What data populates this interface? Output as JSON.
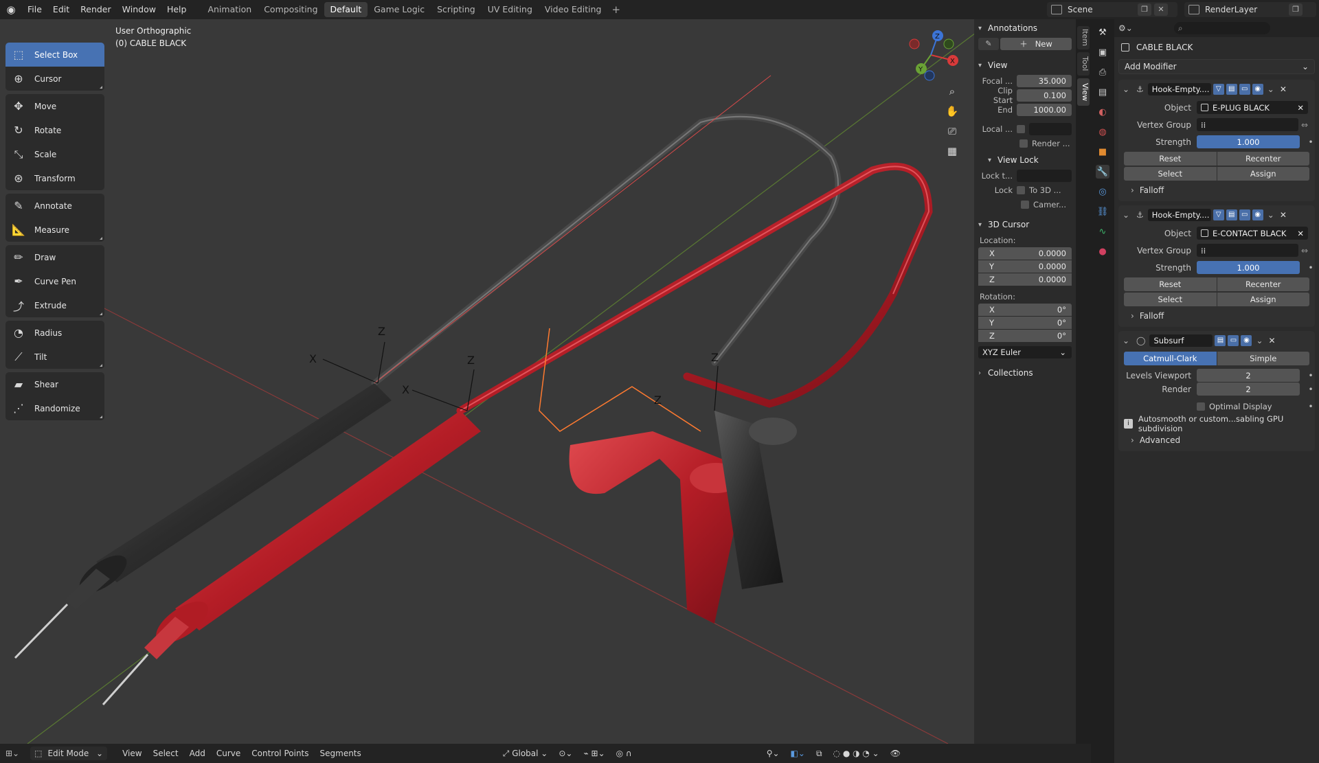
{
  "topbar": {
    "menus": [
      "File",
      "Edit",
      "Render",
      "Window",
      "Help"
    ],
    "workspaces": [
      "Animation",
      "Compositing",
      "Default",
      "Game Logic",
      "Scripting",
      "UV Editing",
      "Video Editing"
    ],
    "active_workspace": "Default",
    "add_tab": "+",
    "scene": "Scene",
    "view_layer": "RenderLayer"
  },
  "viewport": {
    "view_name": "User Orthographic",
    "object_label": "(0) CABLE BLACK",
    "gizmo_axes": [
      "X",
      "Y",
      "Z"
    ]
  },
  "toolbar": {
    "groups": [
      [
        {
          "label": "Select Box",
          "icon": "select-box-icon",
          "active": true
        },
        {
          "label": "Cursor",
          "icon": "cursor-icon"
        }
      ],
      [
        {
          "label": "Move",
          "icon": "move-icon"
        },
        {
          "label": "Rotate",
          "icon": "rotate-icon"
        },
        {
          "label": "Scale",
          "icon": "scale-icon"
        },
        {
          "label": "Transform",
          "icon": "transform-icon"
        }
      ],
      [
        {
          "label": "Annotate",
          "icon": "annotate-icon"
        },
        {
          "label": "Measure",
          "icon": "measure-icon"
        }
      ],
      [
        {
          "label": "Draw",
          "icon": "draw-icon"
        },
        {
          "label": "Curve Pen",
          "icon": "curve-pen-icon"
        },
        {
          "label": "Extrude",
          "icon": "extrude-icon"
        }
      ],
      [
        {
          "label": "Radius",
          "icon": "radius-icon"
        },
        {
          "label": "Tilt",
          "icon": "tilt-icon"
        }
      ],
      [
        {
          "label": "Shear",
          "icon": "shear-icon"
        },
        {
          "label": "Randomize",
          "icon": "randomize-icon"
        }
      ]
    ]
  },
  "npanel": {
    "annotations": {
      "title": "Annotations",
      "new_label": "New"
    },
    "view": {
      "title": "View",
      "focal_label": "Focal ...",
      "focal_value": "35.000",
      "clip_start_label": "Clip Start",
      "clip_start_value": "0.100",
      "end_label": "End",
      "end_value": "1000.00",
      "local_label": "Local ...",
      "render_label": "Render ..."
    },
    "view_lock": {
      "title": "View Lock",
      "lock_to_label": "Lock t...",
      "lock_label": "Lock",
      "to3d_label": "To 3D ...",
      "camera_label": "Camer..."
    },
    "cursor": {
      "title": "3D Cursor",
      "location_label": "Location:",
      "location": [
        {
          "axis": "X",
          "value": "0.0000"
        },
        {
          "axis": "Y",
          "value": "0.0000"
        },
        {
          "axis": "Z",
          "value": "0.0000"
        }
      ],
      "rotation_label": "Rotation:",
      "rotation": [
        {
          "axis": "X",
          "value": "0°"
        },
        {
          "axis": "Y",
          "value": "0°"
        },
        {
          "axis": "Z",
          "value": "0°"
        }
      ],
      "rotation_mode": "XYZ Euler"
    },
    "collections": {
      "title": "Collections"
    },
    "tabs": [
      "Item",
      "Tool",
      "View"
    ]
  },
  "properties": {
    "object_name": "CABLE BLACK",
    "add_modifier": "Add Modifier",
    "modifiers": [
      {
        "name": "Hook-Empty....",
        "object_label": "Object",
        "object_value": "E-PLUG BLACK",
        "vgroup_label": "Vertex Group",
        "strength_label": "Strength",
        "strength_value": "1.000",
        "reset": "Reset",
        "recenter": "Recenter",
        "select": "Select",
        "assign": "Assign",
        "falloff": "Falloff"
      },
      {
        "name": "Hook-Empty....",
        "object_label": "Object",
        "object_value": "E-CONTACT BLACK",
        "vgroup_label": "Vertex Group",
        "strength_label": "Strength",
        "strength_value": "1.000",
        "reset": "Reset",
        "recenter": "Recenter",
        "select": "Select",
        "assign": "Assign",
        "falloff": "Falloff"
      }
    ],
    "subsurf": {
      "name": "Subsurf",
      "catmull": "Catmull-Clark",
      "simple": "Simple",
      "levels_viewport_label": "Levels Viewport",
      "levels_viewport_value": "2",
      "render_label": "Render",
      "render_value": "2",
      "optimal_label": "Optimal Display",
      "warning": "Autosmooth or custom...sabling GPU subdivision",
      "advanced": "Advanced"
    }
  },
  "statusbar": {
    "mode": "Edit Mode",
    "menus": [
      "View",
      "Select",
      "Add",
      "Curve",
      "Control Points",
      "Segments"
    ],
    "orientation": "Global"
  },
  "colors": {
    "accent": "#4772b3",
    "cable_red": "#c8202a",
    "cable_black": "#2a2a2a",
    "axis_x": "#d83a3a",
    "axis_y": "#6aa235",
    "axis_z": "#3c74d6"
  }
}
